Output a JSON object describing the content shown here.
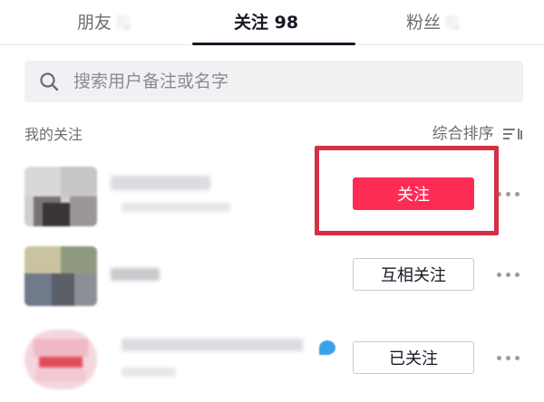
{
  "tabs": [
    {
      "label": "朋友"
    },
    {
      "label": "关注 98"
    },
    {
      "label": "粉丝"
    }
  ],
  "search": {
    "placeholder": "搜索用户备注或名字",
    "value": ""
  },
  "section": {
    "title": "我的关注",
    "sort_label": "综合排序"
  },
  "rows": [
    {
      "button": "关注",
      "button_style": "primary"
    },
    {
      "button": "互相关注",
      "button_style": "outline"
    },
    {
      "button": "已关注",
      "button_style": "outline"
    }
  ],
  "icons": {
    "search": "search-icon",
    "sort": "sort-icon",
    "more": "more-icon"
  },
  "colors": {
    "accent": "#fe2c55",
    "highlight": "#d42f44",
    "text": "#161823",
    "muted": "#6b6c72"
  }
}
